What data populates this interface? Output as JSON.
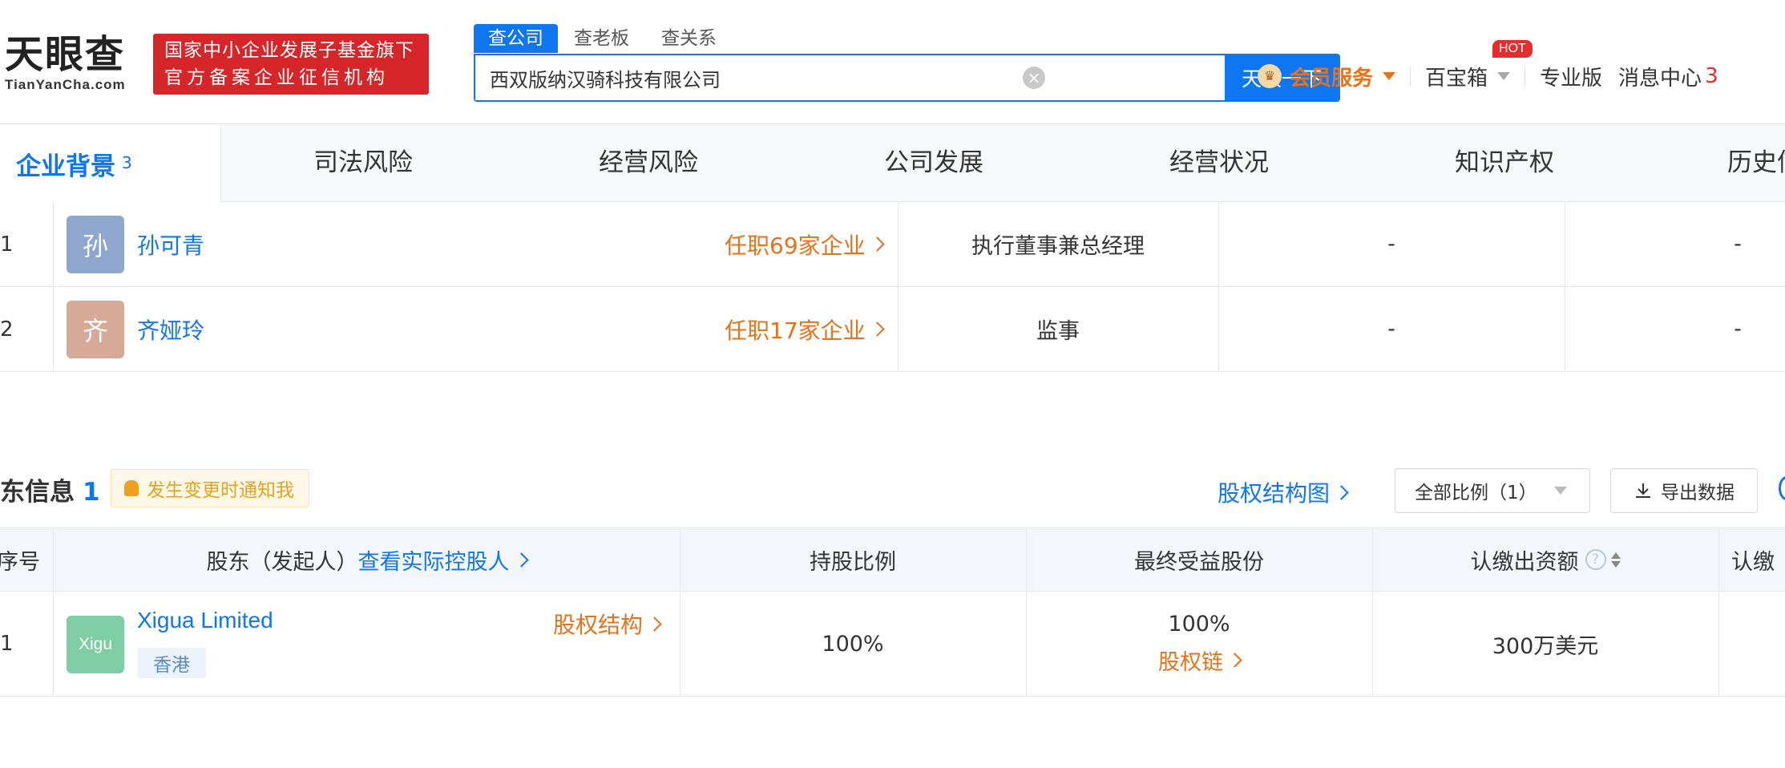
{
  "header": {
    "logo_cn": "天眼查",
    "logo_en": "TianYanCha.com",
    "slogan_line1": "国家中小企业发展子基金旗下",
    "slogan_line2": "官方备案企业征信机构",
    "search_tabs": [
      "查公司",
      "查老板",
      "查关系"
    ],
    "search_value": "西双版纳汉骑科技有限公司",
    "search_button": "天眼一下",
    "vip_label": "会员服务",
    "treasure_label": "百宝箱",
    "hot_badge": "HOT",
    "pro_label": "专业版",
    "message_label": "消息中心",
    "message_count": "3"
  },
  "categories": {
    "active": "企业背景",
    "active_count": "3",
    "items": [
      "司法风险",
      "经营风险",
      "公司发展",
      "经营状况",
      "知识产权",
      "历史信"
    ]
  },
  "staff": [
    {
      "index": "1",
      "avatar_char": "孙",
      "name": "孙可青",
      "posts": "任职69家企业",
      "role": "执行董事兼总经理",
      "col4": "-",
      "col5": "-"
    },
    {
      "index": "2",
      "avatar_char": "齐",
      "name": "齐娅玲",
      "posts": "任职17家企业",
      "role": "监事",
      "col4": "-",
      "col5": "-"
    }
  ],
  "shareholders": {
    "title": "东信息",
    "count": "1",
    "notify": "发生变更时通知我",
    "equity_chart_link": "股权结构图",
    "filter_select": "全部比例（1）",
    "export_button": "导出数据",
    "columns": {
      "index": "序号",
      "holder": "股东（发起人）",
      "holder_link": "查看实际控股人",
      "ratio": "持股比例",
      "beneficial": "最终受益股份",
      "capital": "认缴出资额",
      "capital2": "认缴"
    },
    "rows": [
      {
        "index": "1",
        "avatar_text": "Xigu",
        "name": "Xigua Limited",
        "region": "香港",
        "structure_link": "股权结构",
        "ratio": "100%",
        "beneficial": "100%",
        "chain_link": "股权链",
        "capital": "300万美元"
      }
    ]
  },
  "colors": {
    "brand_blue": "#0e76f0",
    "accent_orange": "#e8721a",
    "slogan_red": "#d6262a",
    "avatar_sun": "#8fa6cf",
    "avatar_qi": "#d7a998",
    "avatar_xigu": "#7fcda4"
  }
}
